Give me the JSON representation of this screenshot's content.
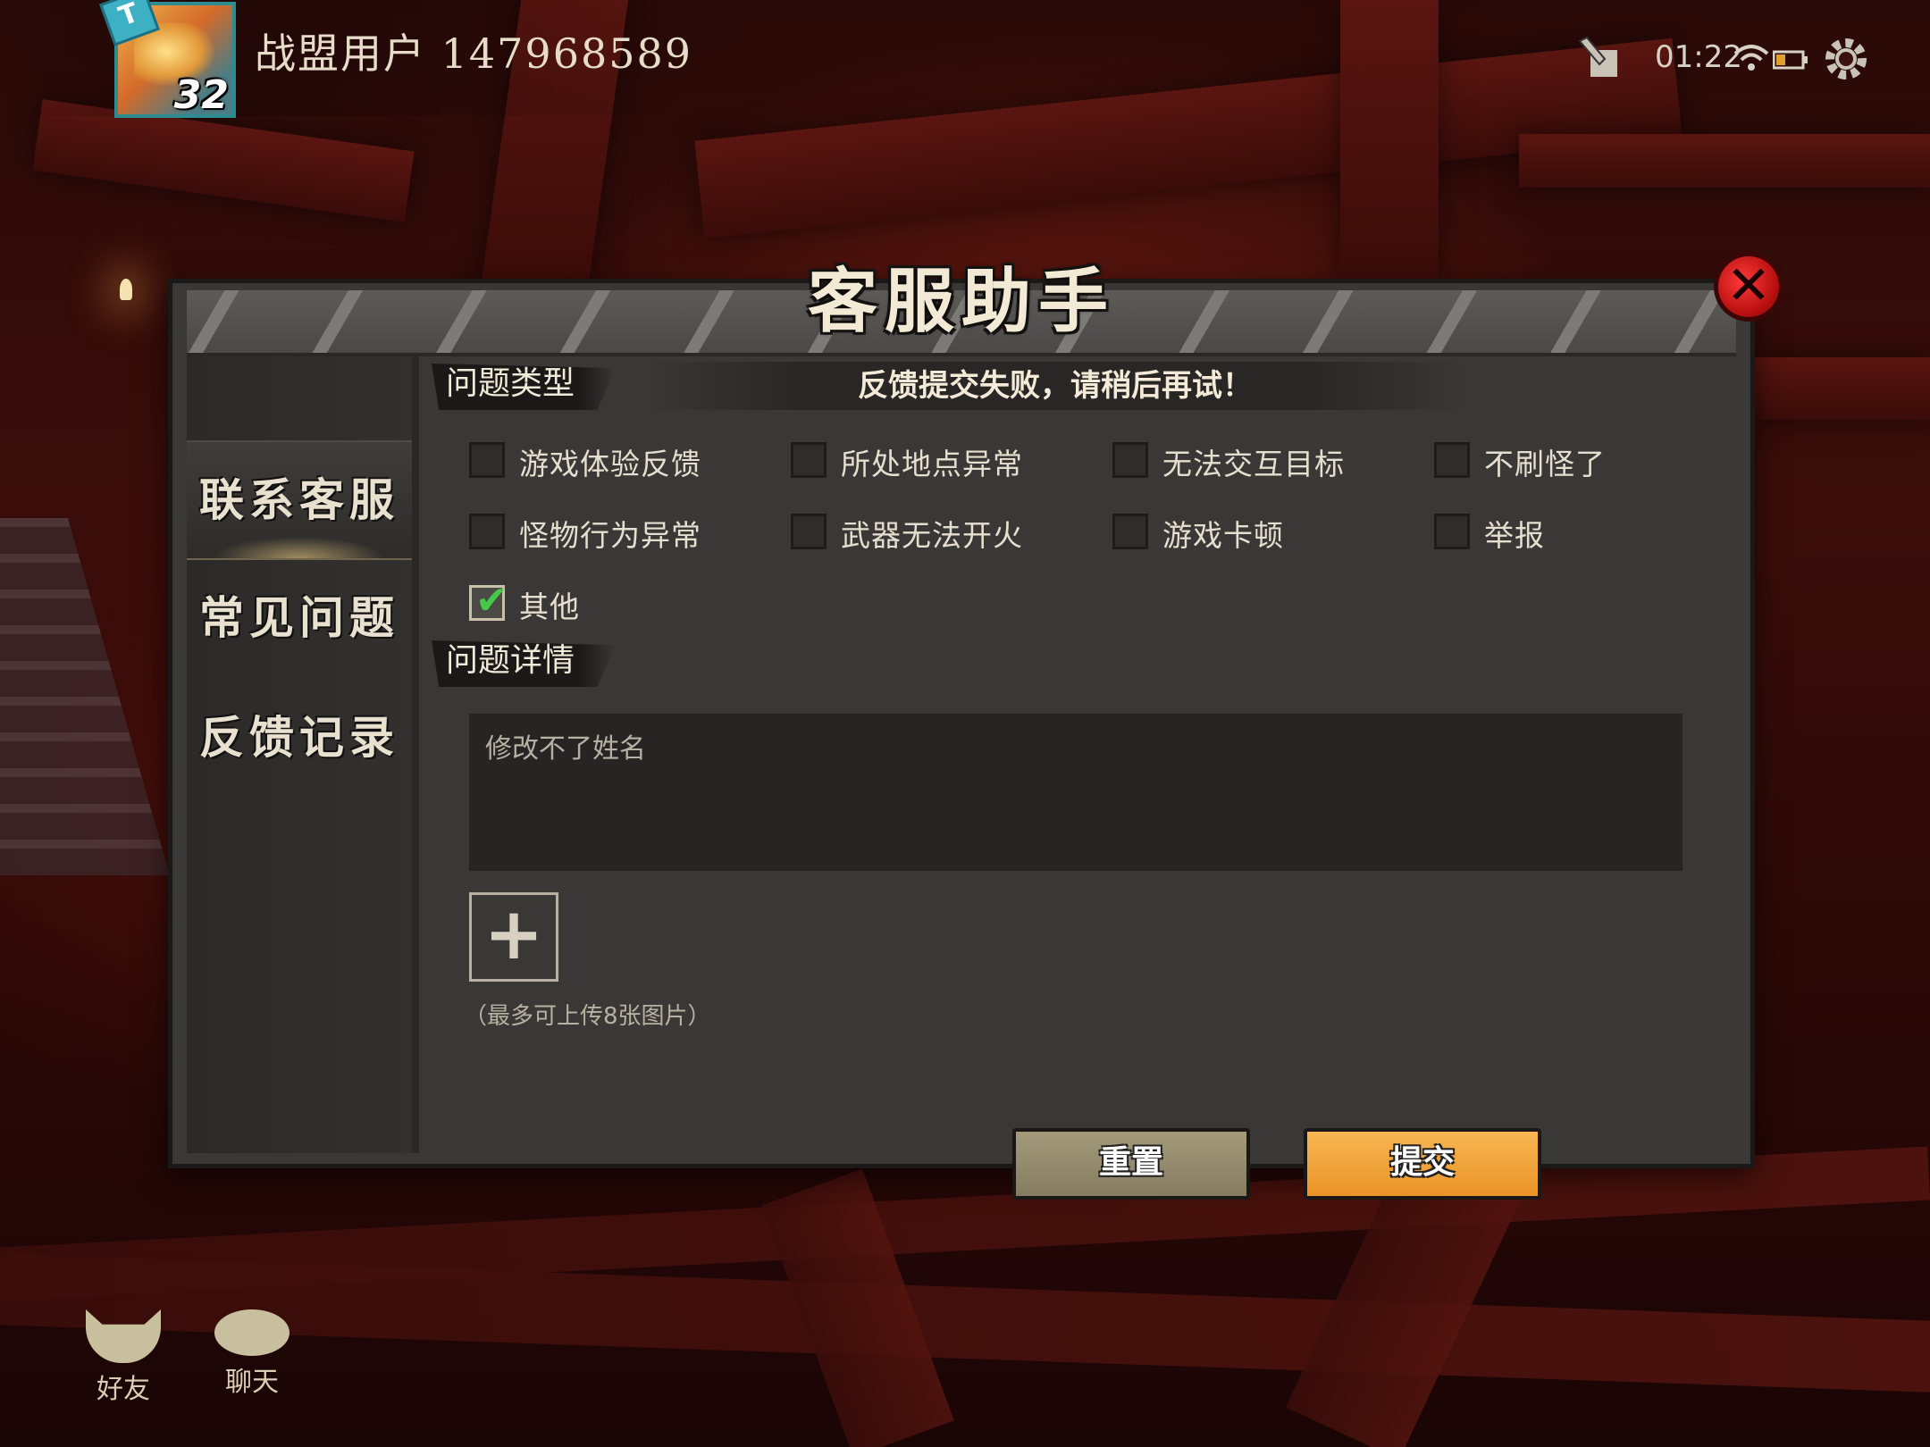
{
  "header": {
    "username": "战盟用户 147968589",
    "avatar_tier": "T",
    "avatar_level": "32",
    "time": "01:22",
    "icons": [
      "edit-icon",
      "wifi-icon",
      "battery-icon",
      "settings-gear-icon"
    ]
  },
  "dialog": {
    "title": "客服助手",
    "close_icon": "close-icon",
    "nav": [
      {
        "label": "联系客服",
        "active": true
      },
      {
        "label": "常见问题",
        "active": false
      },
      {
        "label": "反馈记录",
        "active": false
      }
    ],
    "toast": "反馈提交失败，请稍后再试！",
    "problem_type_label": "问题类型",
    "options": [
      {
        "label": "游戏体验反馈",
        "checked": false
      },
      {
        "label": "所处地点异常",
        "checked": false
      },
      {
        "label": "无法交互目标",
        "checked": false
      },
      {
        "label": "不刷怪了",
        "checked": false
      },
      {
        "label": "怪物行为异常",
        "checked": false
      },
      {
        "label": "武器无法开火",
        "checked": false
      },
      {
        "label": "游戏卡顿",
        "checked": false
      },
      {
        "label": "举报",
        "checked": false
      },
      {
        "label": "其他",
        "checked": true
      }
    ],
    "detail_label": "问题详情",
    "detail_value": "修改不了姓名",
    "upload_plus": "+",
    "upload_hint": "（最多可上传8张图片）",
    "reset_label": "重置",
    "submit_label": "提交"
  },
  "shortcuts": [
    {
      "label": "好友",
      "icon": "friends-icon"
    },
    {
      "label": "聊天",
      "icon": "chat-icon"
    }
  ],
  "colors": {
    "accent_submit": "#ea9428",
    "reset_button": "#958b6d",
    "check_green": "#46c84a",
    "close_red": "#d41a1a"
  }
}
